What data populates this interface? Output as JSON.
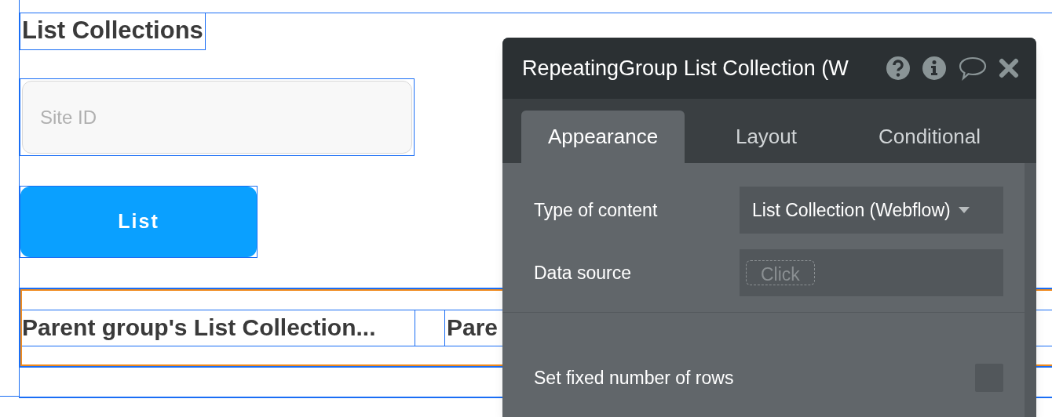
{
  "canvas": {
    "title": "List Collections",
    "input": {
      "placeholder": "Site ID"
    },
    "button": {
      "label": "List"
    },
    "repeating_group": {
      "cells": [
        "Parent group's List Collection...",
        "Pare"
      ]
    }
  },
  "panel": {
    "title": "RepeatingGroup List Collection (W",
    "tabs": [
      {
        "label": "Appearance",
        "selected": true
      },
      {
        "label": "Layout",
        "selected": false
      },
      {
        "label": "Conditional",
        "selected": false
      }
    ],
    "rows": [
      {
        "kind": "dropdown",
        "label": "Type of content",
        "value": "List Collection (Webflow)"
      },
      {
        "kind": "expression",
        "label": "Data source",
        "value": "Click"
      },
      {
        "kind": "checkbox",
        "label": "Set fixed number of rows",
        "checked": false
      }
    ]
  }
}
